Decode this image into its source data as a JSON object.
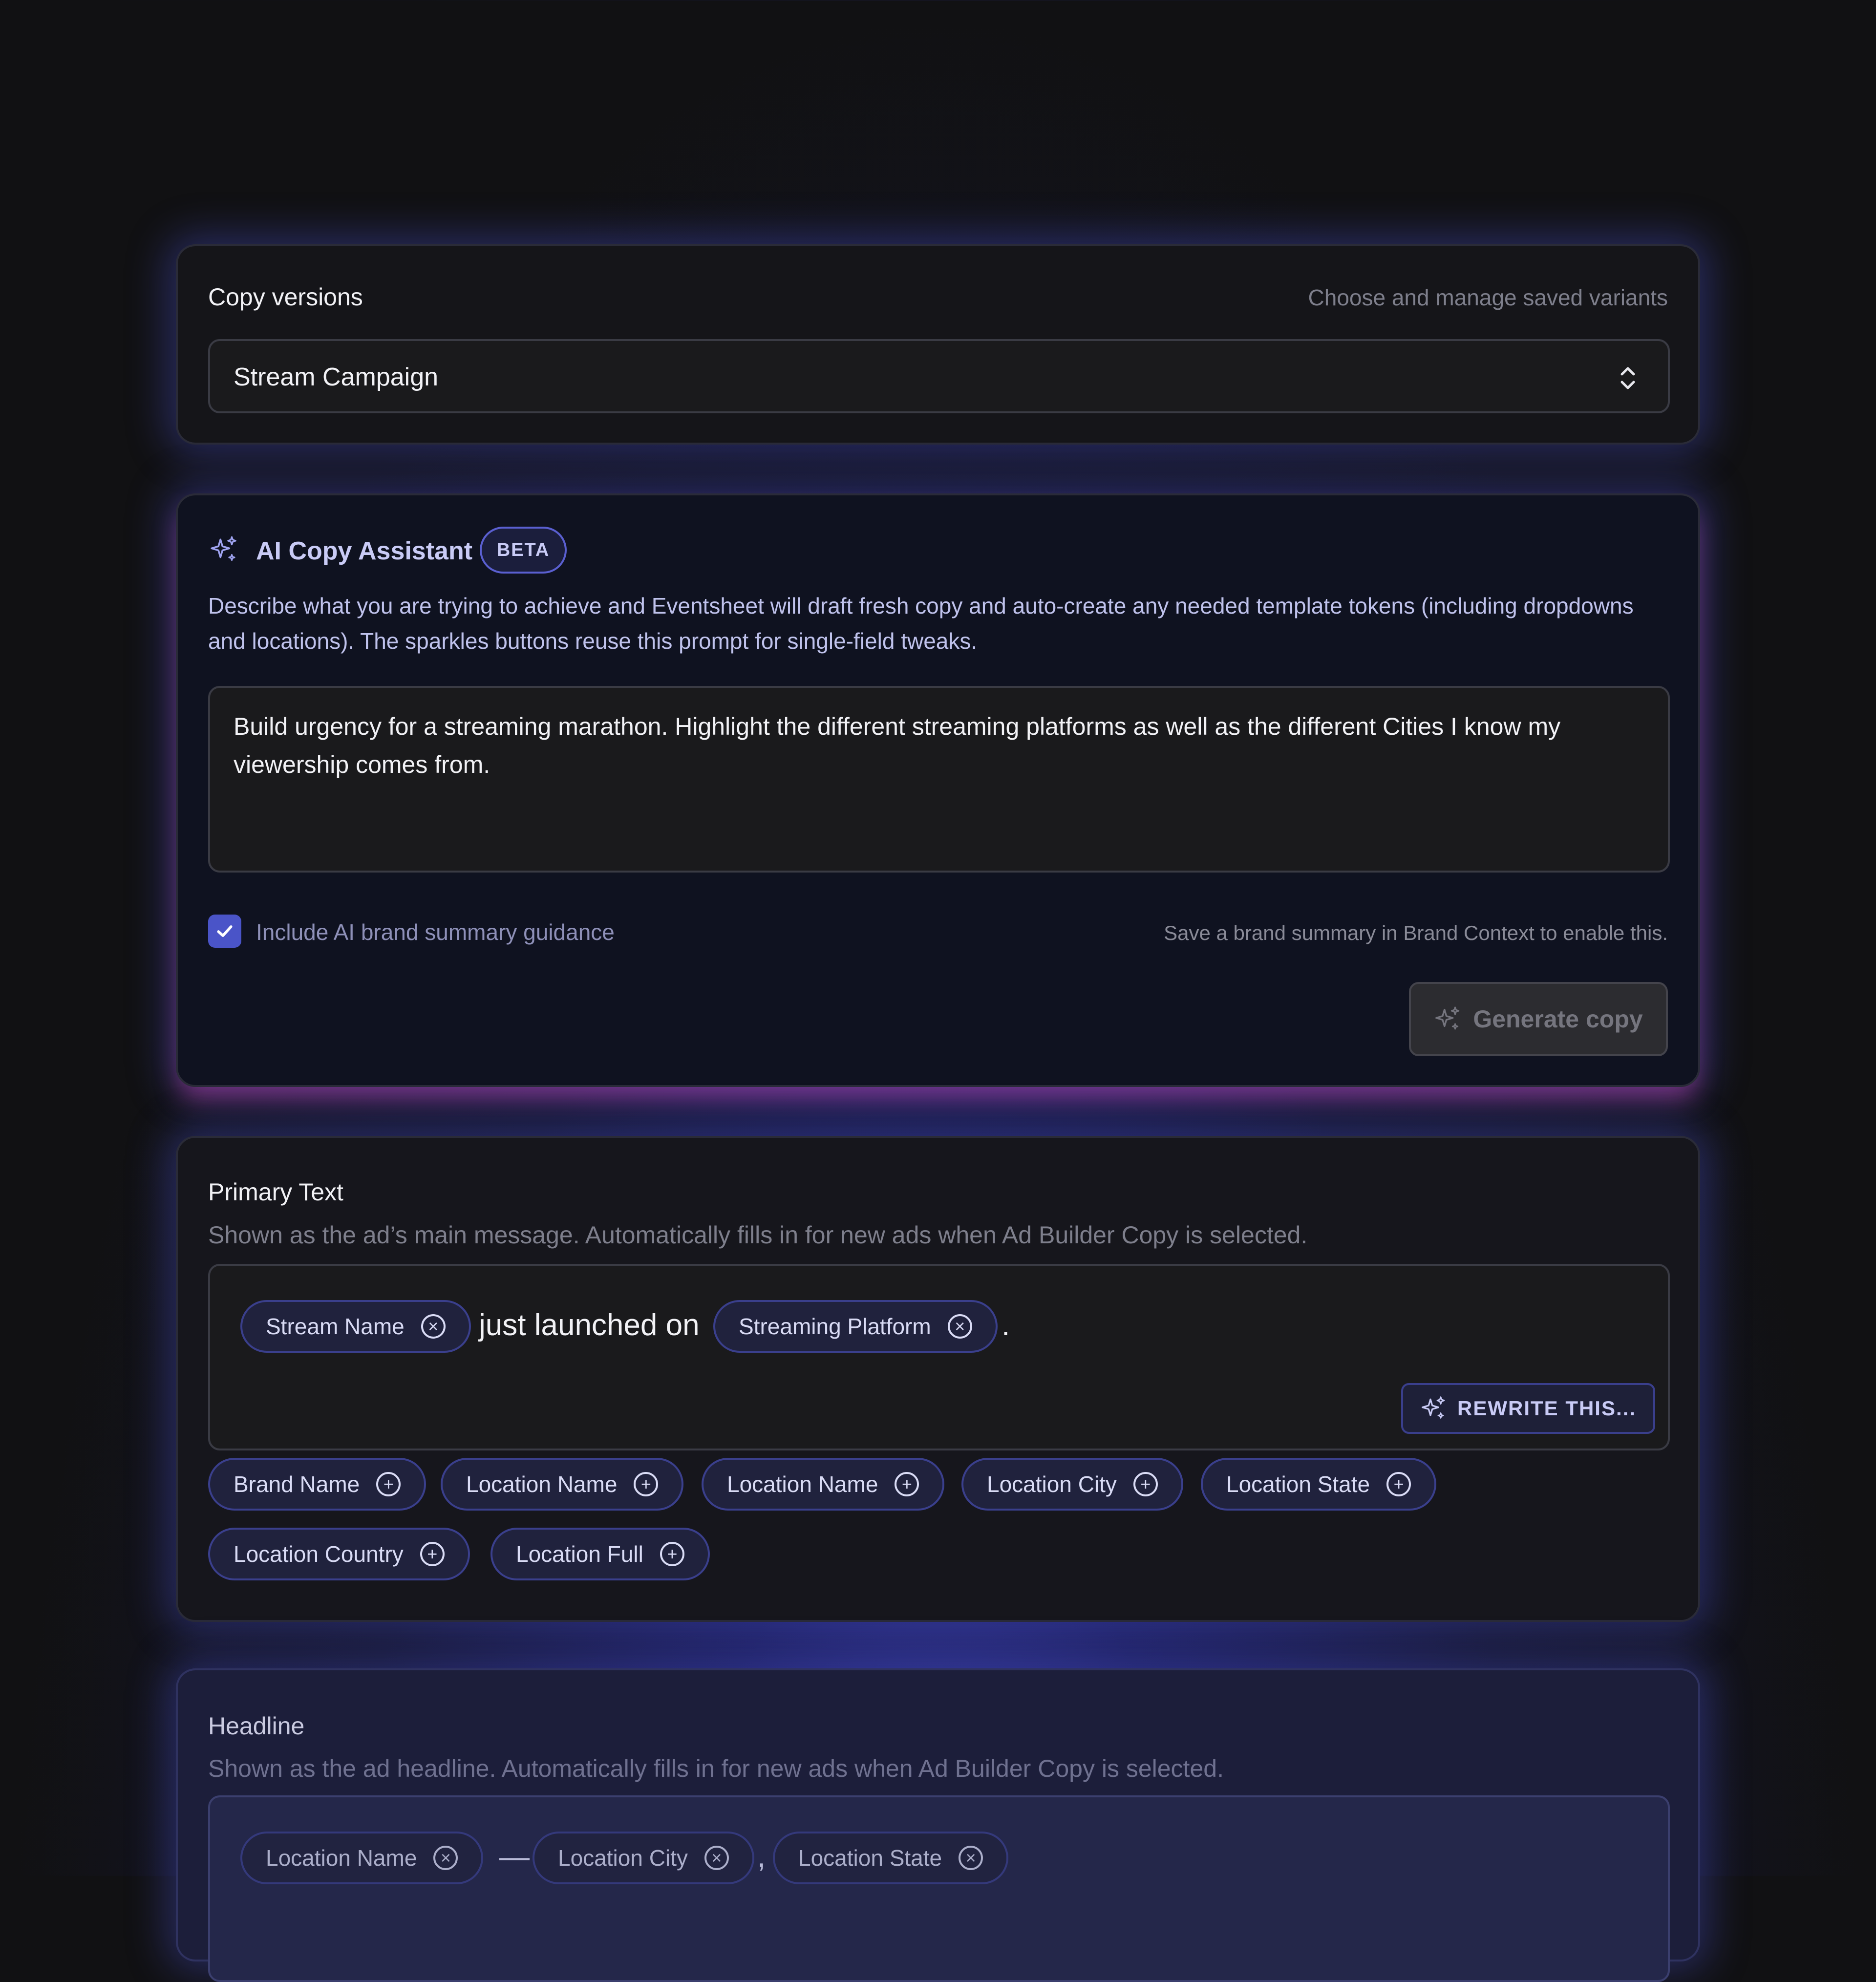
{
  "copy_versions": {
    "title": "Copy versions",
    "hint": "Choose and manage saved variants",
    "selected": "Stream Campaign"
  },
  "assistant": {
    "title": "AI Copy Assistant",
    "badge": "BETA",
    "description_line1": "Describe what you are trying to achieve and Eventsheet will draft fresh copy and auto-create any needed template tokens (including dropdowns",
    "description_line2": "and locations). The sparkles buttons reuse this prompt for single-field tweaks.",
    "prompt_line1": "Build urgency for a streaming marathon. Highlight the different streaming platforms as well as the different Cities I know my",
    "prompt_line2": "viewership comes from.",
    "checkbox_label": "Include AI brand summary guidance",
    "checkbox_checked": true,
    "brand_hint": "Save a brand summary in Brand Context to enable this.",
    "generate_label": "Generate copy"
  },
  "primary_text": {
    "title": "Primary Text",
    "description": "Shown as the ad’s main message. Automatically fills in for new ads when Ad Builder Copy is selected.",
    "token1": "Stream Name",
    "text1": "just launched on",
    "token2": "Streaming Platform",
    "text2": ".",
    "rewrite_label": "REWRITE THIS...",
    "suggestions": [
      "Brand Name",
      "Location Name",
      "Location Name",
      "Location City",
      "Location State",
      "Location Country",
      "Location Full"
    ]
  },
  "headline": {
    "title": "Headline",
    "description": "Shown as the ad headline. Automatically fills in for new ads when Ad Builder Copy is selected.",
    "token1": "Location Name",
    "sep1": "—",
    "token2": "Location City",
    "sep2": ",",
    "token3": "Location State"
  }
}
